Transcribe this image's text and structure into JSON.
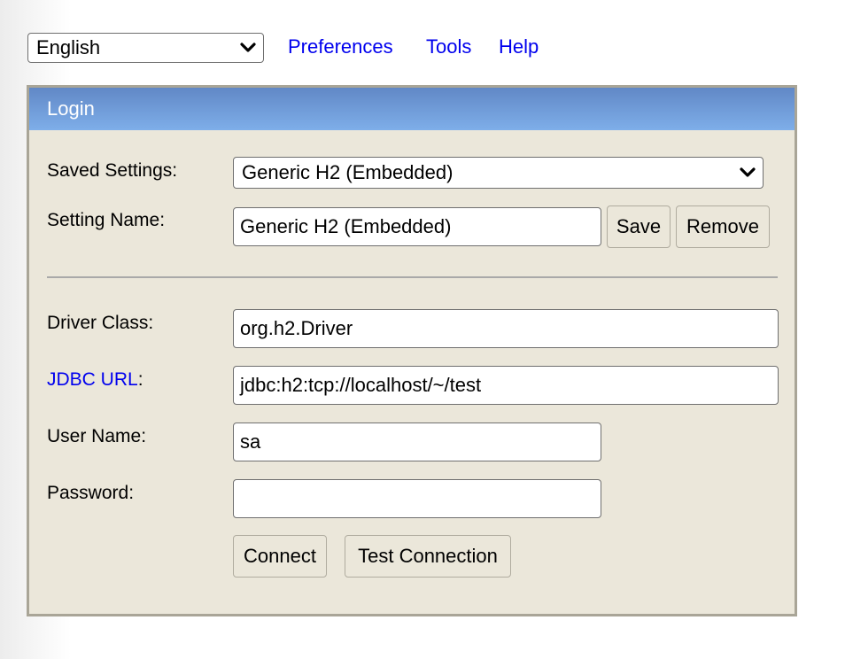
{
  "topbar": {
    "language": {
      "selected": "English"
    },
    "links": [
      {
        "label": "Preferences"
      },
      {
        "label": "Tools"
      },
      {
        "label": "Help"
      }
    ]
  },
  "login_panel": {
    "title": "Login",
    "saved_settings": {
      "label": "Saved Settings:",
      "selected": "Generic H2 (Embedded)"
    },
    "setting_name": {
      "label": "Setting Name:",
      "value": "Generic H2 (Embedded)",
      "save_label": "Save",
      "remove_label": "Remove"
    },
    "driver_class": {
      "label": "Driver Class:",
      "value": "org.h2.Driver"
    },
    "jdbc_url": {
      "label_link": "JDBC URL",
      "label_suffix": ":",
      "value": "jdbc:h2:tcp://localhost/~/test"
    },
    "user_name": {
      "label": "User Name:",
      "value": "sa"
    },
    "password": {
      "label": "Password:",
      "value": ""
    },
    "buttons": {
      "connect_label": "Connect",
      "test_connection_label": "Test Connection"
    }
  },
  "colors": {
    "link": "#0000ee",
    "header_gradient_top": "#6188c6",
    "header_gradient_bottom": "#7eaee9",
    "panel_bg": "#ebe7da",
    "panel_border": "#a9a597"
  }
}
